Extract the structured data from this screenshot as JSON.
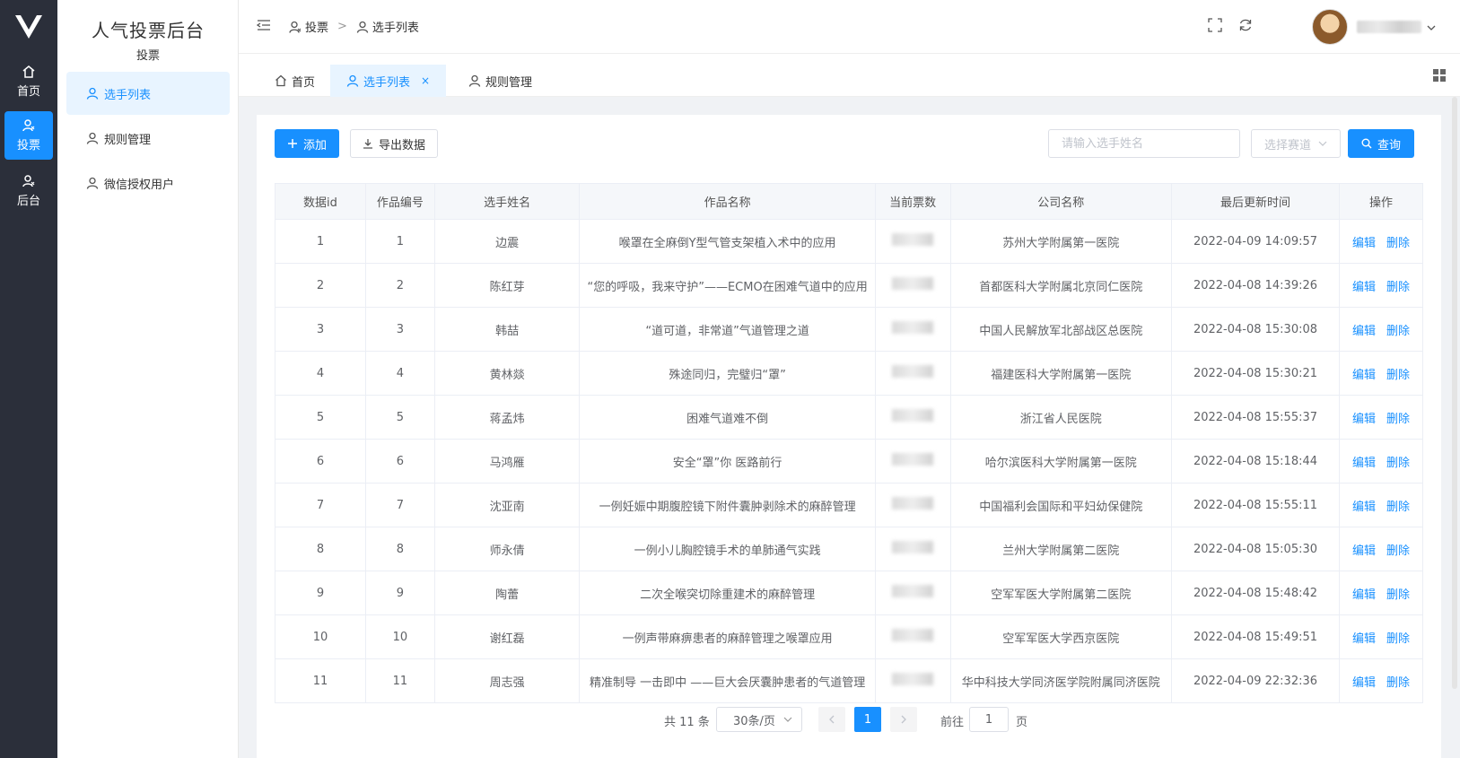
{
  "rail": {
    "items": [
      {
        "label": "首页",
        "icon": "home-icon"
      },
      {
        "label": "投票",
        "icon": "user-group-icon"
      },
      {
        "label": "后台",
        "icon": "user-group-icon"
      }
    ]
  },
  "subnav": {
    "title": "人气投票后台",
    "subtitle": "投票",
    "items": [
      {
        "label": "选手列表"
      },
      {
        "label": "规则管理"
      },
      {
        "label": "微信授权用户"
      }
    ]
  },
  "header": {
    "breadcrumb": [
      "投票",
      "选手列表"
    ],
    "breadcrumb_sep": ">"
  },
  "tabs": [
    {
      "label": "首页"
    },
    {
      "label": "选手列表",
      "close": "×"
    },
    {
      "label": "规则管理"
    }
  ],
  "toolbar": {
    "add_label": "添加",
    "export_label": "导出数据",
    "search_placeholder": "请输入选手姓名",
    "select_placeholder": "选择赛道",
    "query_label": "查询"
  },
  "table": {
    "columns": [
      "数据id",
      "作品编号",
      "选手姓名",
      "作品名称",
      "当前票数",
      "公司名称",
      "最后更新时间",
      "操作"
    ],
    "actions": {
      "edit": "编辑",
      "delete": "删除"
    },
    "rows": [
      {
        "id": "1",
        "no": "1",
        "name": "边震",
        "work": "喉罩在全麻倒Y型气管支架植入术中的应用",
        "company": "苏州大学附属第一医院",
        "time": "2022-04-09 14:09:57"
      },
      {
        "id": "2",
        "no": "2",
        "name": "陈红芽",
        "work": "“您的呼吸，我来守护”——ECMO在困难气道中的应用",
        "company": "首都医科大学附属北京同仁医院",
        "time": "2022-04-08 14:39:26"
      },
      {
        "id": "3",
        "no": "3",
        "name": "韩喆",
        "work": "“道可道，非常道”气道管理之道",
        "company": "中国人民解放军北部战区总医院",
        "time": "2022-04-08 15:30:08"
      },
      {
        "id": "4",
        "no": "4",
        "name": "黄林燚",
        "work": "殊途同归，完璧归“罩”",
        "company": "福建医科大学附属第一医院",
        "time": "2022-04-08 15:30:21"
      },
      {
        "id": "5",
        "no": "5",
        "name": "蒋孟炜",
        "work": "困难气道难不倒",
        "company": "浙江省人民医院",
        "time": "2022-04-08 15:55:37"
      },
      {
        "id": "6",
        "no": "6",
        "name": "马鸿雁",
        "work": "安全“罩”你 医路前行",
        "company": "哈尔滨医科大学附属第一医院",
        "time": "2022-04-08 15:18:44"
      },
      {
        "id": "7",
        "no": "7",
        "name": "沈亚南",
        "work": "一例妊娠中期腹腔镜下附件囊肿剥除术的麻醉管理",
        "company": "中国福利会国际和平妇幼保健院",
        "time": "2022-04-08 15:55:11"
      },
      {
        "id": "8",
        "no": "8",
        "name": "师永倩",
        "work": "一例小儿胸腔镜手术的单肺通气实践",
        "company": "兰州大学附属第二医院",
        "time": "2022-04-08 15:05:30"
      },
      {
        "id": "9",
        "no": "9",
        "name": "陶蕾",
        "work": "二次全喉突切除重建术的麻醉管理",
        "company": "空军军医大学附属第二医院",
        "time": "2022-04-08 15:48:42"
      },
      {
        "id": "10",
        "no": "10",
        "name": "谢红磊",
        "work": "一例声带麻痹患者的麻醉管理之喉罩应用",
        "company": "空军军医大学西京医院",
        "time": "2022-04-08 15:49:51"
      },
      {
        "id": "11",
        "no": "11",
        "name": "周志强",
        "work": "精准制导 一击即中 ——巨大会厌囊肿患者的气道管理",
        "company": "华中科技大学同济医学院附属同济医院",
        "time": "2022-04-09 22:32:36"
      }
    ]
  },
  "pagination": {
    "total_text": "共 11 条",
    "page_size": "30条/页",
    "current_page": "1",
    "goto_label": "前往",
    "goto_value": "1",
    "goto_unit": "页"
  },
  "colors": {
    "primary": "#1890ff",
    "rail": "#2b2f3a"
  }
}
